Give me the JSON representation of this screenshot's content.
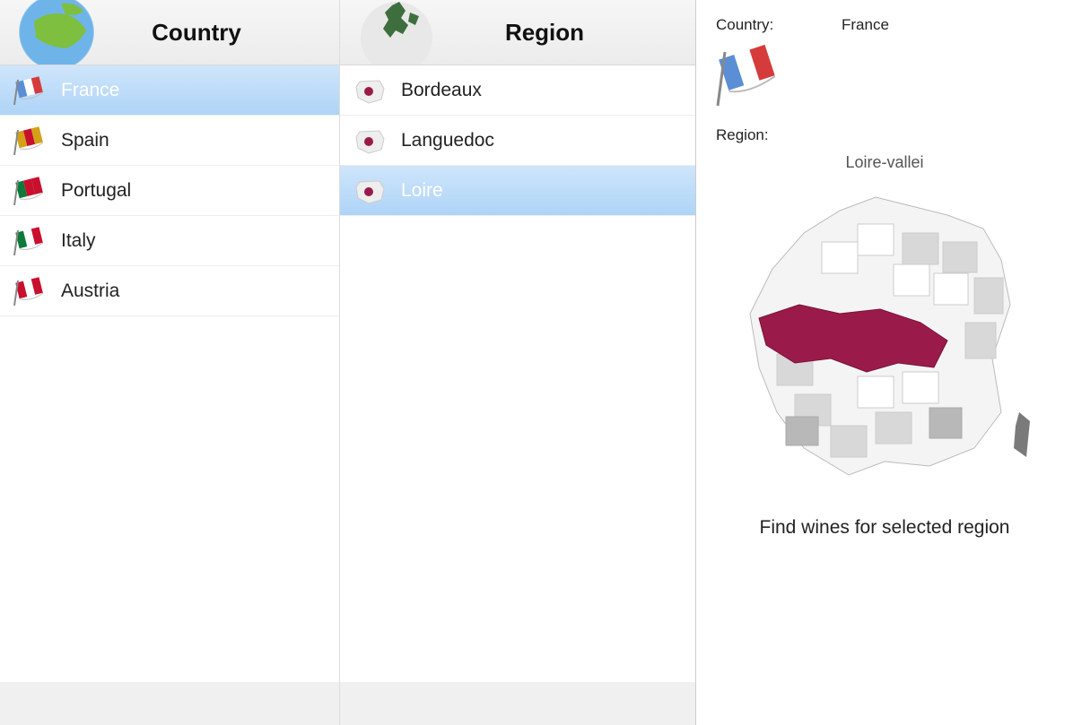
{
  "headers": {
    "country": "Country",
    "region": "Region"
  },
  "countries": [
    {
      "name": "France",
      "flag_colors": [
        "#5a8fd6",
        "#ffffff",
        "#d63b3b"
      ],
      "selected": true
    },
    {
      "name": "Spain",
      "flag_colors": [
        "#d4a017",
        "#c8102e",
        "#d4a017"
      ],
      "selected": false
    },
    {
      "name": "Portugal",
      "flag_colors": [
        "#0b7a3b",
        "#c8102e",
        "#c8102e"
      ],
      "selected": false
    },
    {
      "name": "Italy",
      "flag_colors": [
        "#0b7a3b",
        "#ffffff",
        "#c8102e"
      ],
      "selected": false
    },
    {
      "name": "Austria",
      "flag_colors": [
        "#c8102e",
        "#ffffff",
        "#c8102e"
      ],
      "selected": false
    }
  ],
  "regions": [
    {
      "name": "Bordeaux",
      "selected": false
    },
    {
      "name": "Languedoc",
      "selected": false
    },
    {
      "name": "Loire",
      "selected": true
    }
  ],
  "detail": {
    "country_label": "Country:",
    "country_value": "France",
    "region_label": "Region:",
    "region_display_name": "Loire-vallei",
    "flag_colors": [
      "#5a8fd6",
      "#ffffff",
      "#d63b3b"
    ],
    "action_button": "Find wines for selected region"
  }
}
